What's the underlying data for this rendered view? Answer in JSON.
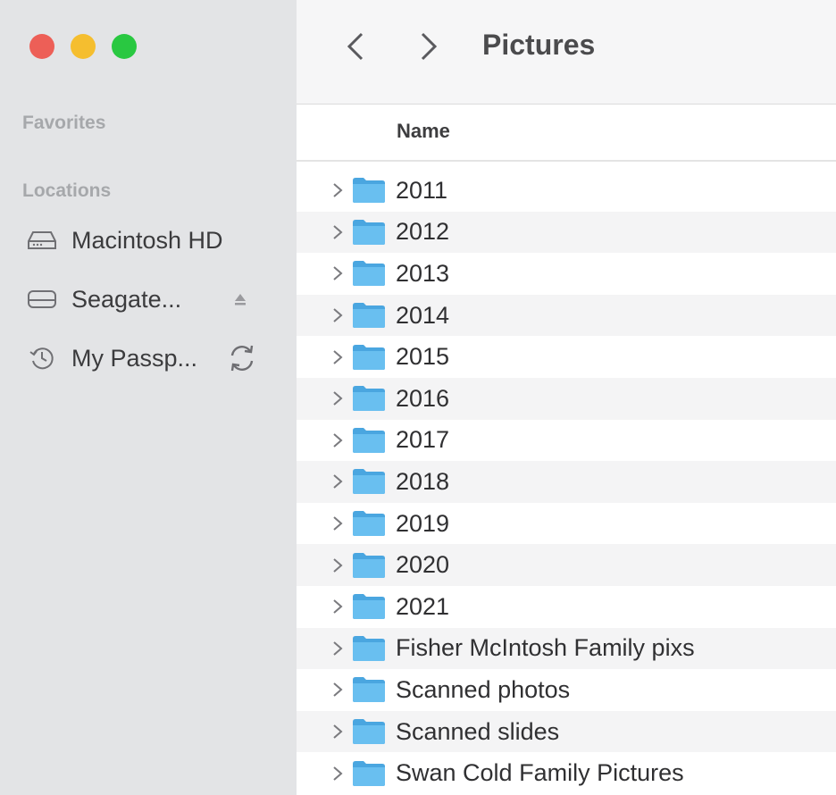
{
  "window": {
    "controls": {
      "close_color": "#ed5f57",
      "minimize_color": "#f5be2f",
      "zoom_color": "#29c841"
    }
  },
  "sidebar": {
    "favorites_title": "Favorites",
    "locations_title": "Locations",
    "locations": [
      {
        "label": "Macintosh HD",
        "icon": "internal-drive-icon"
      },
      {
        "label": "Seagate...",
        "icon": "external-drive-icon",
        "trailing_icon": "eject-icon"
      },
      {
        "label": "My Passp...",
        "icon": "time-machine-icon",
        "trailing_icon": "sync-icon"
      }
    ]
  },
  "toolbar": {
    "title": "Pictures",
    "back_icon": "chevron-left-icon",
    "forward_icon": "chevron-right-icon"
  },
  "list": {
    "column_name": "Name",
    "folder_color": "#5ab4ea",
    "items": [
      "2011",
      "2012",
      "2013",
      "2014",
      "2015",
      "2016",
      "2017",
      "2018",
      "2019",
      "2020",
      "2021",
      "Fisher McIntosh Family pixs",
      "Scanned photos",
      "Scanned slides",
      "Swan Cold Family Pictures"
    ]
  }
}
